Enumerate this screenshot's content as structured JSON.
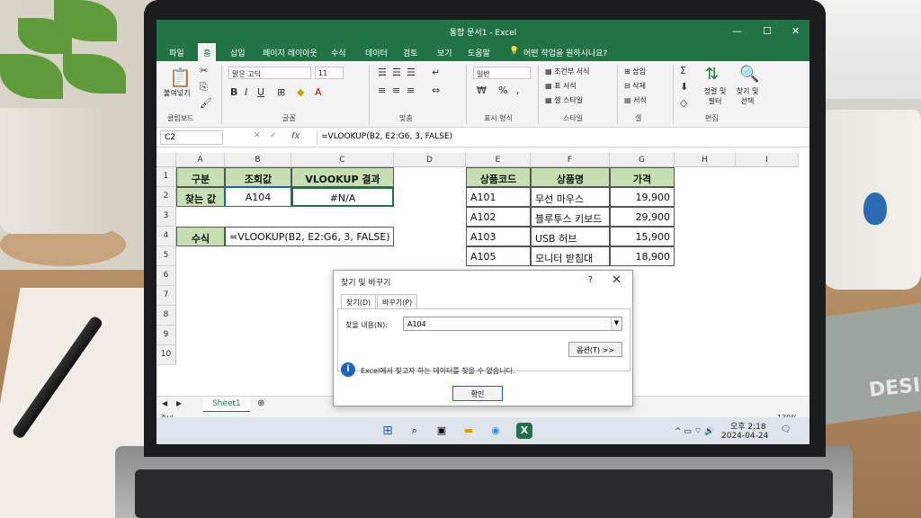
{
  "app": {
    "window_title": "통합 문서1 - Excel",
    "min_label": "—",
    "max_label": "☐",
    "close_label": "✕"
  },
  "menu": {
    "items": [
      "파일",
      "홈",
      "삽입",
      "페이지 레이아웃",
      "수식",
      "데이터",
      "검토",
      "보기",
      "도움말"
    ],
    "active_index": 1,
    "tell_me": "어떤 작업을 원하시나요?"
  },
  "ribbon": {
    "paste": "붙여넣기",
    "font_name": "맑은 고딕",
    "font_size": "11",
    "number_format": "일반",
    "conditional_format": "조건부 서식",
    "table_format": "표 서식",
    "cell_styles": "셀 스타일",
    "insert": "삽입",
    "delete": "삭제",
    "format": "서식",
    "sort_filter": "정렬 및 필터",
    "find_select": "찾기 및 선택",
    "group_labels": [
      "클립보드",
      "글꼴",
      "맞춤",
      "표시 형식",
      "스타일",
      "셀",
      "편집"
    ]
  },
  "formula_bar": {
    "name_box": "C2",
    "fx": "fx",
    "formula": "=VLOOKUP(B2, E2:G6, 3, FALSE)"
  },
  "columns": [
    "A",
    "B",
    "C",
    "D",
    "E",
    "F",
    "G",
    "H",
    "I"
  ],
  "rows": [
    "1",
    "2",
    "3",
    "4",
    "5",
    "6",
    "7",
    "8",
    "9",
    "10"
  ],
  "sheet": {
    "a1": "구분",
    "b1": "조회값",
    "c1": "VLOOKUP 결과",
    "a2": "찾는 값",
    "b2": "A104",
    "c2": "#N/A",
    "a4": "수식",
    "b4": "=VLOOKUP(B2, E2:G6, 3, FALSE)",
    "lookup_headers": [
      "상품코드",
      "상품명",
      "가격"
    ],
    "lookup_rows": [
      [
        "A101",
        "무선 마우스",
        "19,900"
      ],
      [
        "A102",
        "블루투스 키보드",
        "29,900"
      ],
      [
        "A103",
        "USB 허브",
        "15,900"
      ],
      [
        "A105",
        "모니터 받침대",
        "18,900"
      ]
    ]
  },
  "sheet_tabs": [
    "Sheet1"
  ],
  "status": {
    "mode": "준비",
    "zoom": "130%"
  },
  "dialog": {
    "title": "찾기 및 바꾸기",
    "help": "?",
    "close": "✕",
    "tab_find": "찾기(D)",
    "tab_replace": "바꾸기(P)",
    "find_label": "찾을 내용(N):",
    "find_value": "A104",
    "options_button": "옵션(T) >>",
    "message": "Excel에서 찾고자 하는 데이터를 찾을 수 없습니다.",
    "ok_button": "확인",
    "info_icon": "i"
  },
  "taskbar": {
    "time": "오후 2:18",
    "date": "2024-04-24"
  },
  "background": {
    "book_title": "DESIG"
  },
  "colors": {
    "excel_green": "#217346",
    "header_fill": "#c6e0b4",
    "dialog_accent": "#1d63c7"
  }
}
